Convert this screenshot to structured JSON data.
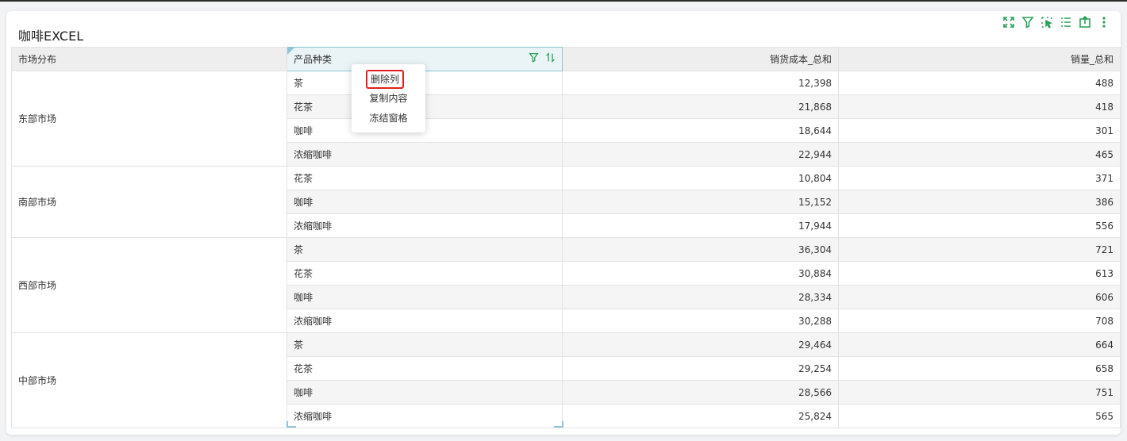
{
  "widget": {
    "title": "咖啡EXCEL",
    "toolbar_icons": [
      "fullscreen-icon",
      "filter-icon",
      "select-icon",
      "list-icon",
      "export-icon",
      "more-icon"
    ]
  },
  "table": {
    "headers": [
      "市场分布",
      "产品种类",
      "销货成本_总和",
      "销量_总和"
    ],
    "groups": [
      {
        "market": "东部市场",
        "rows": [
          {
            "product": "茶",
            "cost": "12,398",
            "qty": "488"
          },
          {
            "product": "花茶",
            "cost": "21,868",
            "qty": "418"
          },
          {
            "product": "咖啡",
            "cost": "18,644",
            "qty": "301"
          },
          {
            "product": "浓缩咖啡",
            "cost": "22,944",
            "qty": "465"
          }
        ]
      },
      {
        "market": "南部市场",
        "rows": [
          {
            "product": "花茶",
            "cost": "10,804",
            "qty": "371"
          },
          {
            "product": "咖啡",
            "cost": "15,152",
            "qty": "386"
          },
          {
            "product": "浓缩咖啡",
            "cost": "17,944",
            "qty": "556"
          }
        ]
      },
      {
        "market": "西部市场",
        "rows": [
          {
            "product": "茶",
            "cost": "36,304",
            "qty": "721"
          },
          {
            "product": "花茶",
            "cost": "30,884",
            "qty": "613"
          },
          {
            "product": "咖啡",
            "cost": "28,334",
            "qty": "606"
          },
          {
            "product": "浓缩咖啡",
            "cost": "30,288",
            "qty": "708"
          }
        ]
      },
      {
        "market": "中部市场",
        "rows": [
          {
            "product": "茶",
            "cost": "29,464",
            "qty": "664"
          },
          {
            "product": "花茶",
            "cost": "29,254",
            "qty": "658"
          },
          {
            "product": "咖啡",
            "cost": "28,566",
            "qty": "751"
          },
          {
            "product": "浓缩咖啡",
            "cost": "25,824",
            "qty": "565"
          }
        ]
      }
    ]
  },
  "context_menu": {
    "items": [
      "删除列",
      "复制内容",
      "冻结窗格"
    ],
    "highlighted_color": "#e02020"
  },
  "colors": {
    "accent_green": "#2aa15a",
    "selection": "#8ec6d6"
  }
}
